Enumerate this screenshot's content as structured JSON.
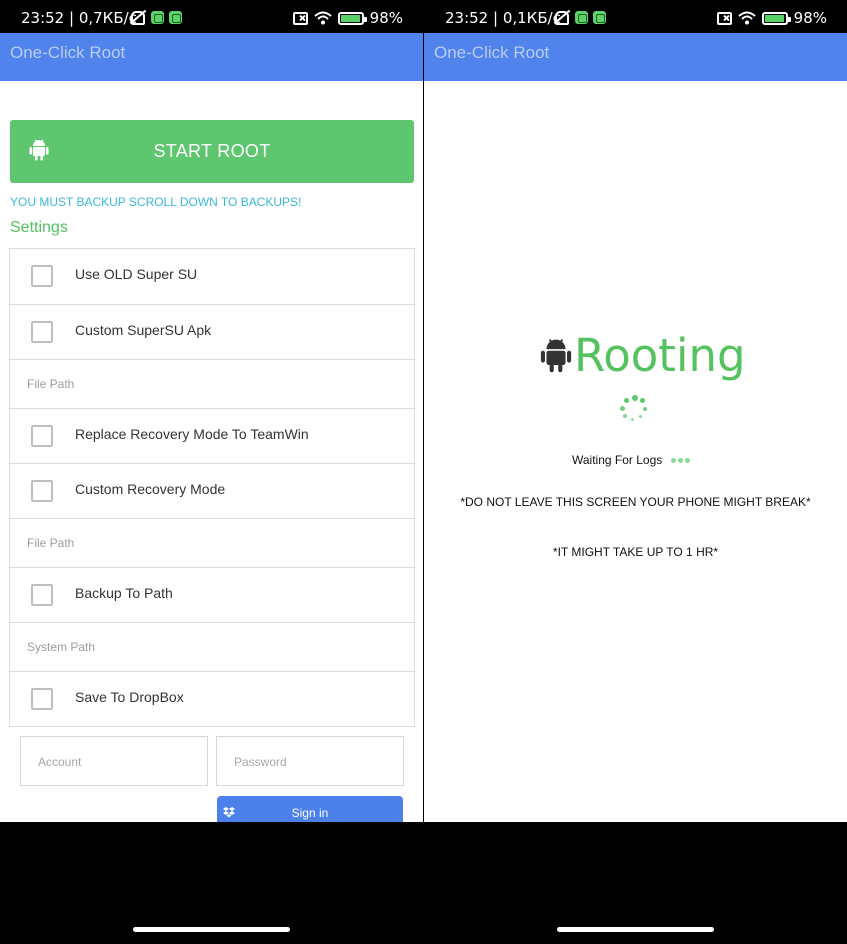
{
  "status_bar_left": {
    "time": "23:52",
    "speed": "0,7КБ/с",
    "battery": "98%"
  },
  "status_bar_right": {
    "time": "23:52",
    "speed": "0,1КБ/с",
    "battery": "98%"
  },
  "app": {
    "title": "One-Click Root"
  },
  "root_screen": {
    "start_button": "START ROOT",
    "warning": "YOU MUST BACKUP SCROLL DOWN TO BACKUPS!",
    "settings_title": "Settings",
    "settings": [
      {
        "type": "checkbox",
        "label": "Use OLD Super SU",
        "checked": false
      },
      {
        "type": "checkbox",
        "label": "Custom SuperSU Apk",
        "checked": false
      },
      {
        "type": "input",
        "placeholder": "File Path"
      },
      {
        "type": "checkbox",
        "label": "Replace Recovery Mode To TeamWin",
        "checked": false
      },
      {
        "type": "checkbox",
        "label": "Custom Recovery Mode",
        "checked": false
      },
      {
        "type": "input",
        "placeholder": "File Path"
      },
      {
        "type": "checkbox",
        "label": "Backup To Path",
        "checked": false
      },
      {
        "type": "input",
        "placeholder": "System Path"
      },
      {
        "type": "checkbox",
        "label": "Save To DropBox",
        "checked": false
      }
    ],
    "account_placeholder": "Account",
    "password_placeholder": "Password",
    "sign_in": "Sign in"
  },
  "rooting_screen": {
    "title": "Rooting",
    "waiting": "Waiting For Logs",
    "warning_1": "*DO NOT LEAVE THIS SCREEN YOUR PHONE MIGHT BREAK*",
    "warning_2": "*IT MIGHT TAKE UP TO 1 HR*"
  },
  "colors": {
    "appbar": "#5183ec",
    "accent_green": "#5ec66e",
    "warning_blue": "#3ab9d6"
  },
  "icons": [
    "android-icon",
    "dropbox-icon",
    "spinner-icon",
    "wifi-icon",
    "battery-icon",
    "sim-icon",
    "mute-icon"
  ]
}
